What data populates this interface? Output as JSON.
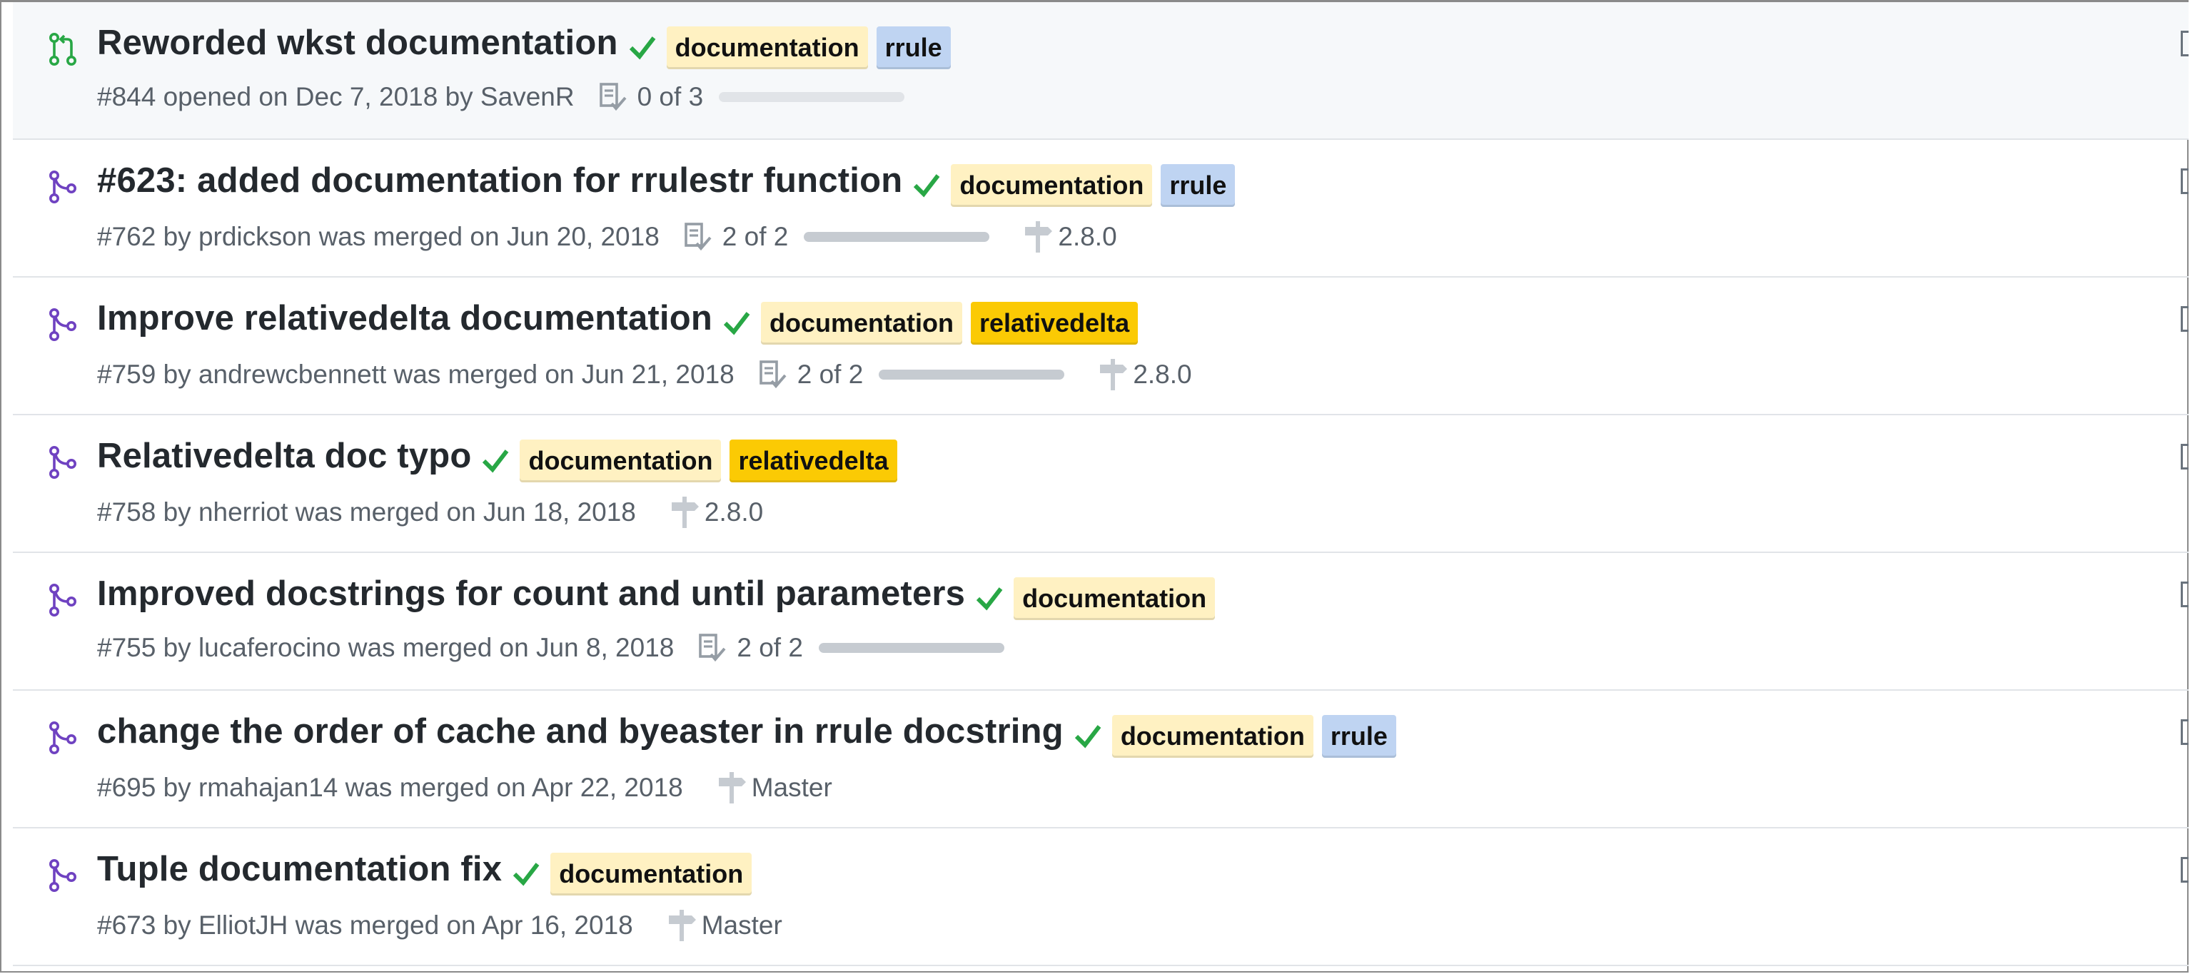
{
  "colors": {
    "open_icon": "#28a745",
    "merged_icon": "#6f42c1",
    "check": "#28a745",
    "label_documentation": "#fff1c2",
    "label_rrule": "#bfd4f2",
    "label_relativedelta": "#fbca04"
  },
  "pull_requests": [
    {
      "state": "open",
      "title": "Reworded wkst documentation",
      "labels": [
        {
          "name": "documentation",
          "color": "#fff1c2"
        },
        {
          "name": "rrule",
          "color": "#bfd4f2"
        }
      ],
      "meta": "#844 opened on Dec 7, 2018 by SavenR",
      "tasks": "0 of 3",
      "task_progress": 0.0,
      "milestone": ""
    },
    {
      "state": "merged",
      "title": "#623: added documentation for rrulestr function",
      "labels": [
        {
          "name": "documentation",
          "color": "#fff1c2"
        },
        {
          "name": "rrule",
          "color": "#bfd4f2"
        }
      ],
      "meta": "#762 by prdickson was merged on Jun 20, 2018",
      "tasks": "2 of 2",
      "task_progress": 1.0,
      "milestone": "2.8.0"
    },
    {
      "state": "merged",
      "title": "Improve relativedelta documentation",
      "labels": [
        {
          "name": "documentation",
          "color": "#fff1c2"
        },
        {
          "name": "relativedelta",
          "color": "#fbca04"
        }
      ],
      "meta": "#759 by andrewcbennett was merged on Jun 21, 2018",
      "tasks": "2 of 2",
      "task_progress": 1.0,
      "milestone": "2.8.0"
    },
    {
      "state": "merged",
      "title": "Relativedelta doc typo",
      "labels": [
        {
          "name": "documentation",
          "color": "#fff1c2"
        },
        {
          "name": "relativedelta",
          "color": "#fbca04"
        }
      ],
      "meta": "#758 by nherriot was merged on Jun 18, 2018",
      "tasks": "",
      "task_progress": null,
      "milestone": "2.8.0"
    },
    {
      "state": "merged",
      "title": "Improved docstrings for count and until parameters",
      "labels": [
        {
          "name": "documentation",
          "color": "#fff1c2"
        }
      ],
      "meta": "#755 by lucaferocino was merged on Jun 8, 2018",
      "tasks": "2 of 2",
      "task_progress": 1.0,
      "milestone": ""
    },
    {
      "state": "merged",
      "title": "change the order of cache and byeaster in rrule docstring",
      "labels": [
        {
          "name": "documentation",
          "color": "#fff1c2"
        },
        {
          "name": "rrule",
          "color": "#bfd4f2"
        }
      ],
      "meta": "#695 by rmahajan14 was merged on Apr 22, 2018",
      "tasks": "",
      "task_progress": null,
      "milestone": "Master"
    },
    {
      "state": "merged",
      "title": "Tuple documentation fix",
      "labels": [
        {
          "name": "documentation",
          "color": "#fff1c2"
        }
      ],
      "meta": "#673 by ElliotJH was merged on Apr 16, 2018",
      "tasks": "",
      "task_progress": null,
      "milestone": "Master"
    }
  ]
}
